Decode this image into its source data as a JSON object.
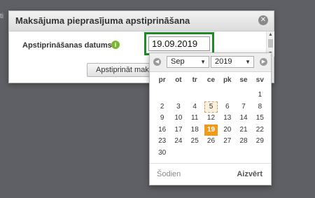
{
  "dialog": {
    "title": "Maksājuma pieprasījuma apstiprināšana",
    "close_icon": "close-icon",
    "field_label": "Apstiprināšanas datums",
    "info_icon": "i",
    "date_value": "19.09.2019",
    "confirm_button": "Apstiprināt maks"
  },
  "calendar": {
    "month": "Sep",
    "year": "2019",
    "weekdays": [
      "pr",
      "ot",
      "tr",
      "ce",
      "pk",
      "se",
      "sv"
    ],
    "weeks": [
      [
        "",
        "",
        "",
        "",
        "",
        "",
        "1"
      ],
      [
        "2",
        "3",
        "4",
        "5",
        "6",
        "7",
        "8"
      ],
      [
        "9",
        "10",
        "11",
        "12",
        "13",
        "14",
        "15"
      ],
      [
        "16",
        "17",
        "18",
        "19",
        "20",
        "21",
        "22"
      ],
      [
        "23",
        "24",
        "25",
        "26",
        "27",
        "28",
        "29"
      ],
      [
        "30",
        "",
        "",
        "",
        "",
        "",
        ""
      ]
    ],
    "today_day": "5",
    "selected_day": "19",
    "today_label": "Šodien",
    "close_label": "Aizvērt",
    "accent_color": "#ef9a1a",
    "highlight_color": "#1e8a28"
  }
}
